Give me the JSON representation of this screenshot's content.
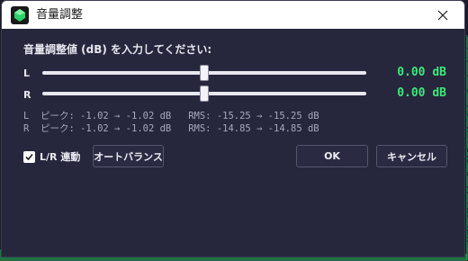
{
  "window": {
    "title": "音量調整"
  },
  "main": {
    "heading": "音量調整値 (dB) を入力してください:",
    "channels": [
      {
        "label": "L",
        "slider_value_db": 0.0,
        "value_text": "0.00 dB",
        "stats": "L  ピーク: -1.02 → -1.02 dB   RMS: -15.25 → -15.25 dB"
      },
      {
        "label": "R",
        "slider_value_db": 0.0,
        "value_text": "0.00 dB",
        "stats": "R  ピーク: -1.02 → -1.02 dB   RMS: -14.85 → -14.85 dB"
      }
    ]
  },
  "controls": {
    "link_label": "L/R 連動",
    "link_checked": true,
    "auto_balance_label": "オートバランス",
    "ok_label": "OK",
    "cancel_label": "キャンセル"
  },
  "colors": {
    "accent_value": "#3ee87a",
    "background_wave": "#23c95a"
  }
}
